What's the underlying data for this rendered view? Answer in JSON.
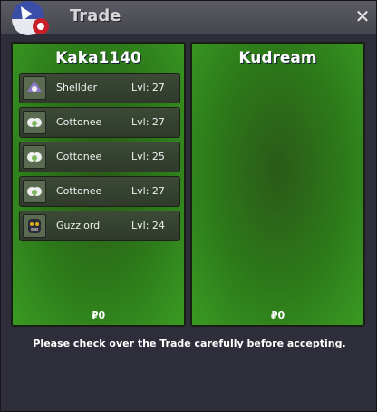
{
  "window": {
    "title": "Trade",
    "close_label": "✕"
  },
  "left_panel": {
    "player": "Kaka1140",
    "money": "₽0",
    "pokemon": [
      {
        "name": "Shellder",
        "level": "Lvl: 27",
        "icon": "shellder-icon"
      },
      {
        "name": "Cottonee",
        "level": "Lvl: 27",
        "icon": "cottonee-icon"
      },
      {
        "name": "Cottonee",
        "level": "Lvl: 25",
        "icon": "cottonee-icon"
      },
      {
        "name": "Cottonee",
        "level": "Lvl: 27",
        "icon": "cottonee-icon"
      },
      {
        "name": "Guzzlord",
        "level": "Lvl: 24",
        "icon": "guzzlord-icon"
      }
    ]
  },
  "right_panel": {
    "player": "Kudream",
    "money": "₽0",
    "pokemon": []
  },
  "footer": {
    "message": "Please check over the Trade carefully before accepting."
  }
}
